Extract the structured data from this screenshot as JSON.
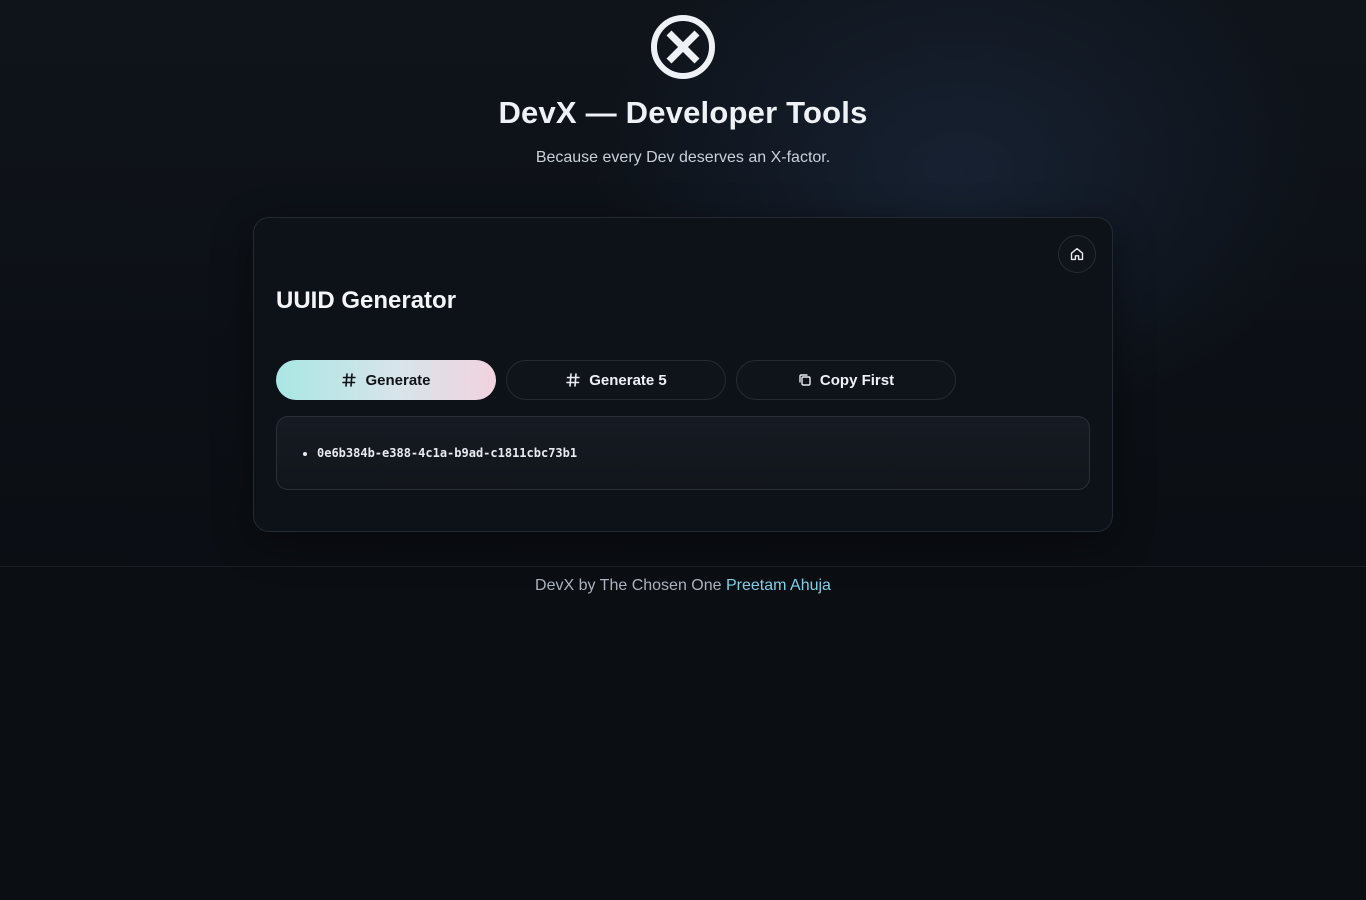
{
  "header": {
    "logo_icon": "x-circle-icon",
    "title": "DevX — Developer Tools",
    "tagline": "Because every Dev deserves an X-factor."
  },
  "tool": {
    "title": "UUID Generator",
    "home_icon": "home-icon",
    "buttons": {
      "generate_label": "Generate",
      "generate5_label": "Generate 5",
      "copy_first_label": "Copy First"
    },
    "results": [
      "0e6b384b-e388-4c1a-b9ad-c1811cbc73b1"
    ]
  },
  "footer": {
    "prefix": "DevX by The Chosen One",
    "author_link": "Preetam Ahuja"
  },
  "colors": {
    "accent_gradient_start": "#a9e6e4",
    "accent_gradient_end": "#f1d3df",
    "link": "#7fd0e6",
    "background": "#0b0e13"
  }
}
